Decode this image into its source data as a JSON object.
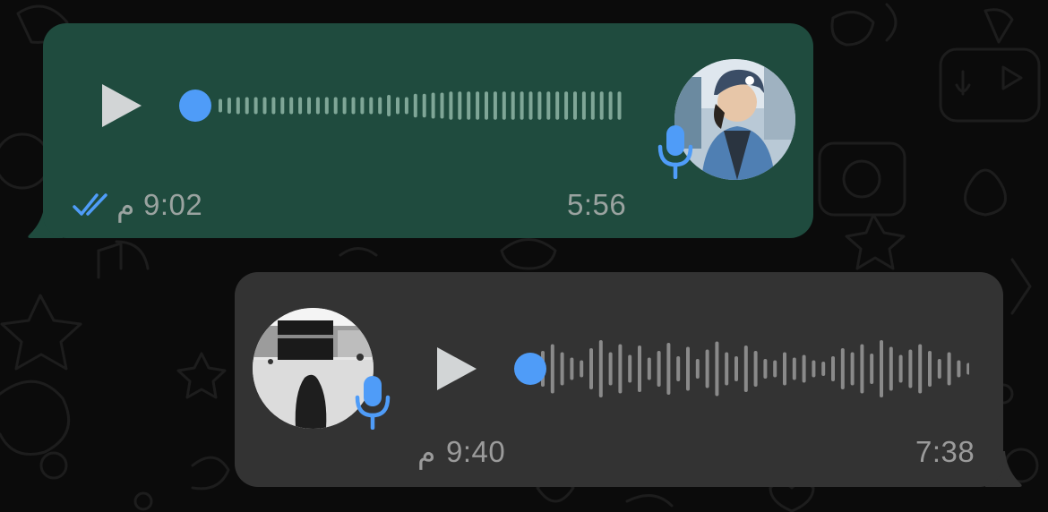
{
  "colors": {
    "background": "#0b0b0b",
    "outgoing_bubble": "#1f4b3e",
    "incoming_bubble": "#333333",
    "accent_blue": "#4f9cf8",
    "waveform_out": "#7fa697",
    "waveform_in": "#8a8a8a",
    "play_icon": "#d2d5d6"
  },
  "messages": [
    {
      "direction": "outgoing",
      "type": "voice-note",
      "time": "9:02",
      "period_suffix": "م",
      "duration": "5:56",
      "status_icon": "double-check-read-icon",
      "play_icon": "play-icon",
      "mic_icon": "microphone-icon",
      "progress": 0,
      "waveform_levels": [
        0.22,
        0.28,
        0.3,
        0.3,
        0.3,
        0.3,
        0.3,
        0.3,
        0.3,
        0.3,
        0.3,
        0.3,
        0.3,
        0.3,
        0.3,
        0.3,
        0.3,
        0.3,
        0.3,
        0.4,
        0.3,
        0.3,
        0.45,
        0.45,
        0.5,
        0.5,
        0.55,
        0.55,
        0.55,
        0.55,
        0.55,
        0.55,
        0.55,
        0.55,
        0.55,
        0.55,
        0.55,
        0.55,
        0.55,
        0.55,
        0.55,
        0.55,
        0.55,
        0.55,
        0.55,
        0.55,
        0.35
      ]
    },
    {
      "direction": "incoming",
      "type": "voice-note",
      "time": "9:40",
      "period_suffix": "م",
      "duration": "7:38",
      "play_icon": "play-icon",
      "mic_icon": "microphone-icon",
      "progress": 0,
      "waveform_levels": [
        0.6,
        0.85,
        0.55,
        0.35,
        0.25,
        0.7,
        1.0,
        0.55,
        0.85,
        0.45,
        0.8,
        0.35,
        0.6,
        0.9,
        0.4,
        0.75,
        0.3,
        0.65,
        0.95,
        0.55,
        0.4,
        0.8,
        0.6,
        0.3,
        0.25,
        0.55,
        0.35,
        0.45,
        0.25,
        0.2,
        0.4,
        0.7,
        0.55,
        0.85,
        0.5,
        1.0,
        0.75,
        0.45,
        0.65,
        0.85,
        0.6,
        0.3,
        0.55,
        0.25,
        0.15
      ]
    }
  ]
}
